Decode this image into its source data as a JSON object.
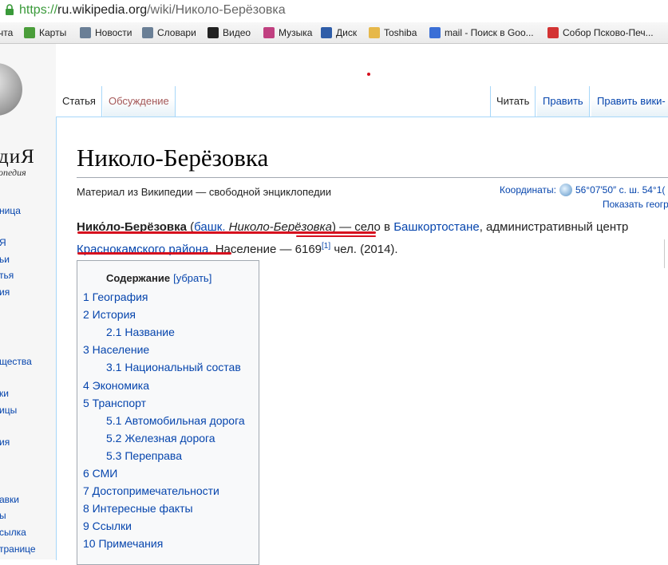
{
  "browser": {
    "url_scheme": "https://",
    "url_host": "ru.wikipedia.org",
    "url_path": "/wiki/Николо-Берёзовка",
    "bookmarks": [
      {
        "label": "чта",
        "icon": "apps-icon",
        "color": "#ffffff"
      },
      {
        "label": "Карты",
        "icon": "maps-icon",
        "color": "#4a9d3a"
      },
      {
        "label": "Новости",
        "icon": "news-icon",
        "color": "#6a7f96"
      },
      {
        "label": "Словари",
        "icon": "dictionary-icon",
        "color": "#6a7f96"
      },
      {
        "label": "Видео",
        "icon": "video-icon",
        "color": "#222222"
      },
      {
        "label": "Музыка",
        "icon": "music-icon",
        "color": "#c04080"
      },
      {
        "label": "Диск",
        "icon": "mail-icon",
        "color": "#2f5da8"
      },
      {
        "label": "Toshiba",
        "icon": "folder-icon",
        "color": "#e6b84a"
      },
      {
        "label": "mail - Поиск в Goo...",
        "icon": "google-icon",
        "color": "#3b6fd6"
      },
      {
        "label": "Собор Псково-Печ...",
        "icon": "yandex-icon",
        "color": "#d33333"
      }
    ]
  },
  "sidebar": {
    "logo_title": "диЯ",
    "logo_subtitle": "опедия",
    "links": [
      "ница",
      "Я",
      "ьи",
      "тья",
      "ия",
      "щества",
      "ки",
      "ицы",
      "ия",
      "авки",
      "ы",
      "сылка",
      "транице"
    ]
  },
  "tabs": {
    "left": [
      "Статья",
      "Обсуждение"
    ],
    "right": [
      "Читать",
      "Править",
      "Править вики-"
    ]
  },
  "article": {
    "title": "Николо-Берёзовка",
    "tagline": "Материал из Википедии — свободной энциклопедии",
    "coords_label": "Координаты:",
    "coords_value": "56°07′50″ с. ш. 54°1(",
    "show_geo": "Показать геогр",
    "lead": {
      "bold": "Нико́ло-Берёзовка",
      "paren_open": " (",
      "bash_abbr": "башк.",
      "bash_name": " Николо-Берёзовка",
      "paren_close": ") — село в ",
      "link1": "Башкортостане",
      "mid": ", административный центр",
      "link2": "Краснокамского района",
      "tail": ". Население — 6169",
      "ref": "[1]",
      "end": " чел. (2014)."
    }
  },
  "toc": {
    "heading": "Содержание",
    "hide": "[убрать]",
    "items": [
      {
        "text": "1 География",
        "level": 1
      },
      {
        "text": "2 История",
        "level": 1
      },
      {
        "text": "2.1 Название",
        "level": 2
      },
      {
        "text": "3 Население",
        "level": 1
      },
      {
        "text": "3.1 Национальный состав",
        "level": 2
      },
      {
        "text": "4 Экономика",
        "level": 1
      },
      {
        "text": "5 Транспорт",
        "level": 1
      },
      {
        "text": "5.1 Автомобильная дорога",
        "level": 2
      },
      {
        "text": "5.2 Железная дорога",
        "level": 2
      },
      {
        "text": "5.3 Переправа",
        "level": 2
      },
      {
        "text": "6 СМИ",
        "level": 1
      },
      {
        "text": "7 Достопримечательности",
        "level": 1
      },
      {
        "text": "8 Интересные факты",
        "level": 1
      },
      {
        "text": "9 Ссылки",
        "level": 1
      },
      {
        "text": "10 Примечания",
        "level": 1
      }
    ]
  }
}
